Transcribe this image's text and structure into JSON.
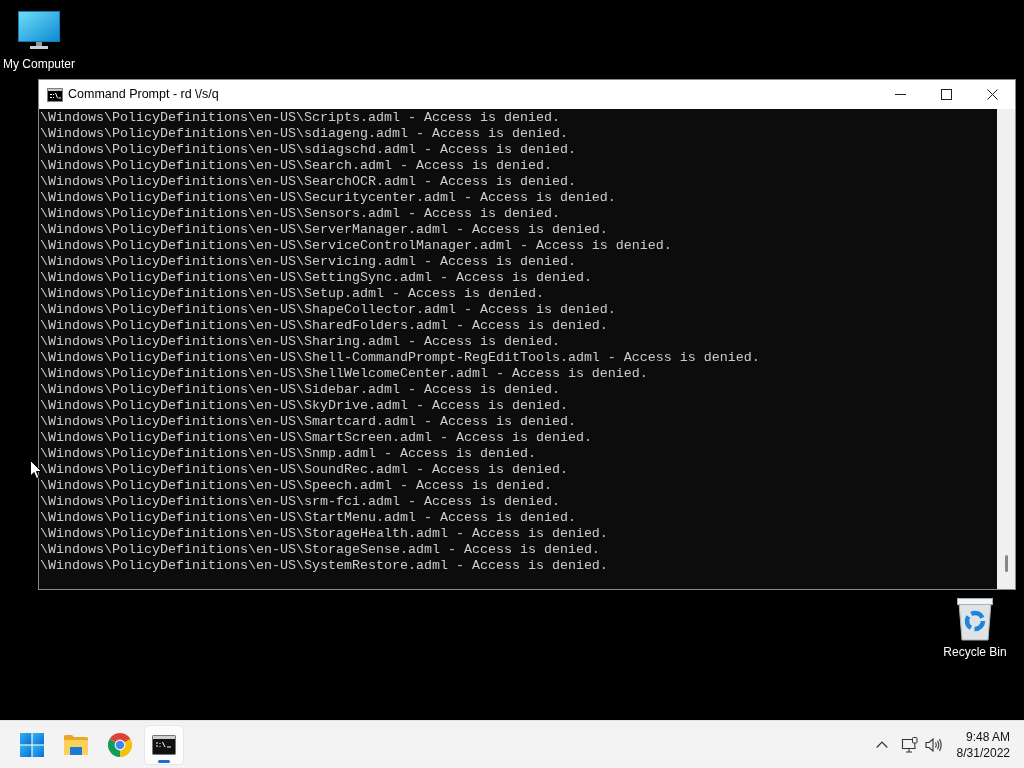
{
  "desktop_icons": [
    {
      "kind": "computer",
      "label": "My Computer"
    },
    {
      "kind": "recycle_bin",
      "label": "Recycle Bin"
    }
  ],
  "window": {
    "title": "Command Prompt - rd \\/s/q",
    "console_lines": [
      "\\Windows\\PolicyDefinitions\\en-US\\Scripts.adml - Access is denied.",
      "\\Windows\\PolicyDefinitions\\en-US\\sdiageng.adml - Access is denied.",
      "\\Windows\\PolicyDefinitions\\en-US\\sdiagschd.adml - Access is denied.",
      "\\Windows\\PolicyDefinitions\\en-US\\Search.adml - Access is denied.",
      "\\Windows\\PolicyDefinitions\\en-US\\SearchOCR.adml - Access is denied.",
      "\\Windows\\PolicyDefinitions\\en-US\\Securitycenter.adml - Access is denied.",
      "\\Windows\\PolicyDefinitions\\en-US\\Sensors.adml - Access is denied.",
      "\\Windows\\PolicyDefinitions\\en-US\\ServerManager.adml - Access is denied.",
      "\\Windows\\PolicyDefinitions\\en-US\\ServiceControlManager.adml - Access is denied.",
      "\\Windows\\PolicyDefinitions\\en-US\\Servicing.adml - Access is denied.",
      "\\Windows\\PolicyDefinitions\\en-US\\SettingSync.adml - Access is denied.",
      "\\Windows\\PolicyDefinitions\\en-US\\Setup.adml - Access is denied.",
      "\\Windows\\PolicyDefinitions\\en-US\\ShapeCollector.adml - Access is denied.",
      "\\Windows\\PolicyDefinitions\\en-US\\SharedFolders.adml - Access is denied.",
      "\\Windows\\PolicyDefinitions\\en-US\\Sharing.adml - Access is denied.",
      "\\Windows\\PolicyDefinitions\\en-US\\Shell-CommandPrompt-RegEditTools.adml - Access is denied.",
      "\\Windows\\PolicyDefinitions\\en-US\\ShellWelcomeCenter.adml - Access is denied.",
      "\\Windows\\PolicyDefinitions\\en-US\\Sidebar.adml - Access is denied.",
      "\\Windows\\PolicyDefinitions\\en-US\\SkyDrive.adml - Access is denied.",
      "\\Windows\\PolicyDefinitions\\en-US\\Smartcard.adml - Access is denied.",
      "\\Windows\\PolicyDefinitions\\en-US\\SmartScreen.adml - Access is denied.",
      "\\Windows\\PolicyDefinitions\\en-US\\Snmp.adml - Access is denied.",
      "\\Windows\\PolicyDefinitions\\en-US\\SoundRec.adml - Access is denied.",
      "\\Windows\\PolicyDefinitions\\en-US\\Speech.adml - Access is denied.",
      "\\Windows\\PolicyDefinitions\\en-US\\srm-fci.adml - Access is denied.",
      "\\Windows\\PolicyDefinitions\\en-US\\StartMenu.adml - Access is denied.",
      "\\Windows\\PolicyDefinitions\\en-US\\StorageHealth.adml - Access is denied.",
      "\\Windows\\PolicyDefinitions\\en-US\\StorageSense.adml - Access is denied.",
      "\\Windows\\PolicyDefinitions\\en-US\\SystemRestore.adml - Access is denied."
    ]
  },
  "taskbar": {
    "apps": [
      {
        "kind": "start",
        "selected": false
      },
      {
        "kind": "explorer",
        "selected": false
      },
      {
        "kind": "chrome",
        "selected": false
      },
      {
        "kind": "terminal",
        "selected": true
      }
    ],
    "clock": {
      "time": "9:48 AM",
      "date": "8/31/2022"
    }
  }
}
